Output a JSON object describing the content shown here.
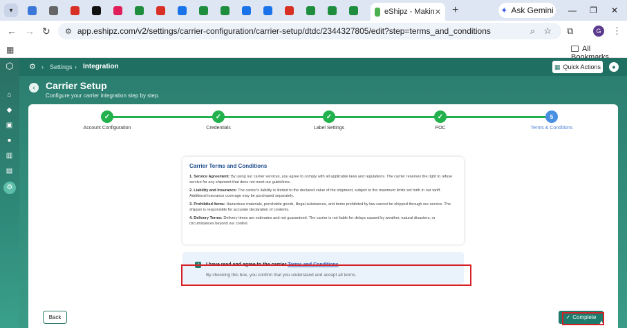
{
  "browser": {
    "active_tab_title": "eShipz - Makin",
    "gemini_label": "Ask Gemini",
    "url": "app.eshipz.com/v2/settings/carrier-configuration/carrier-setup/dtdc/2344327805/edit?step=terms_and_conditions",
    "all_bookmarks_label": "All Bookmarks",
    "profile_initial": "G",
    "pinned_tabs": [
      {
        "icon": "meet-icon",
        "color": "#3b77d8"
      },
      {
        "icon": "chrome-icon",
        "color": "#666666"
      },
      {
        "icon": "gmail-icon",
        "color": "#d93025"
      },
      {
        "icon": "x-icon",
        "color": "#111111"
      },
      {
        "icon": "slack-icon",
        "color": "#e01e5a"
      },
      {
        "icon": "sheets-icon",
        "color": "#1e8e3e"
      },
      {
        "icon": "chrome-ext-icon",
        "color": "#d93025"
      },
      {
        "icon": "cloud-icon",
        "color": "#1a73e8"
      },
      {
        "icon": "sheets-icon",
        "color": "#1e8e3e"
      },
      {
        "icon": "sheets-icon",
        "color": "#1e8e3e"
      },
      {
        "icon": "link-icon",
        "color": "#1a73e8"
      },
      {
        "icon": "link-icon",
        "color": "#1a73e8"
      },
      {
        "icon": "alert-icon",
        "color": "#d93025"
      },
      {
        "icon": "app-icon",
        "color": "#1e8e3e"
      },
      {
        "icon": "app-icon",
        "color": "#1e8e3e"
      },
      {
        "icon": "sheets-icon",
        "color": "#1e8e3e"
      }
    ]
  },
  "header": {
    "breadcrumb_settings": "Settings",
    "breadcrumb_current": "Integration",
    "quick_actions": "Quick Actions"
  },
  "page": {
    "title": "Carrier Setup",
    "subtitle": "Configure your carrier integration step by step."
  },
  "steps": [
    {
      "label": "Account Configuration",
      "status": "done",
      "marker": "✓"
    },
    {
      "label": "Credentials",
      "status": "done",
      "marker": "✓"
    },
    {
      "label": "Label Settings",
      "status": "done",
      "marker": "✓"
    },
    {
      "label": "POC",
      "status": "done",
      "marker": "✓"
    },
    {
      "label": "Terms & Conditions",
      "status": "current",
      "marker": "5"
    }
  ],
  "terms": {
    "heading": "Carrier Terms and Conditions",
    "items": [
      {
        "title": "1. Service Agreement:",
        "text": " By using our carrier services, you agree to comply with all applicable laws and regulations. The carrier reserves the right to refuse service for any shipment that does not meet our guidelines."
      },
      {
        "title": "2. Liability and Insurance:",
        "text": " The carrier's liability is limited to the declared value of the shipment, subject to the maximum limits set forth in our tariff. Additional insurance coverage may be purchased separately."
      },
      {
        "title": "3. Prohibited Items:",
        "text": " Hazardous materials, perishable goods, illegal substances, and items prohibited by law cannot be shipped through our service. The shipper is responsible for accurate declaration of contents."
      },
      {
        "title": "4. Delivery Terms:",
        "text": " Delivery times are estimates and not guaranteed. The carrier is not liable for delays caused by weather, natural disasters, or circumstances beyond our control."
      }
    ]
  },
  "agreement": {
    "checked": true,
    "label_prefix": "I have read and agree to the carrier ",
    "label_link": "Terms and Conditions",
    "subtext": "By checking this box, you confirm that you understand and accept all terms."
  },
  "footer": {
    "back_label": "Back",
    "complete_label": "Complete"
  },
  "colors": {
    "brand": "#1f6f62",
    "step_done": "#22b14c",
    "step_current": "#4a90e2",
    "highlight": "#d61f26"
  }
}
